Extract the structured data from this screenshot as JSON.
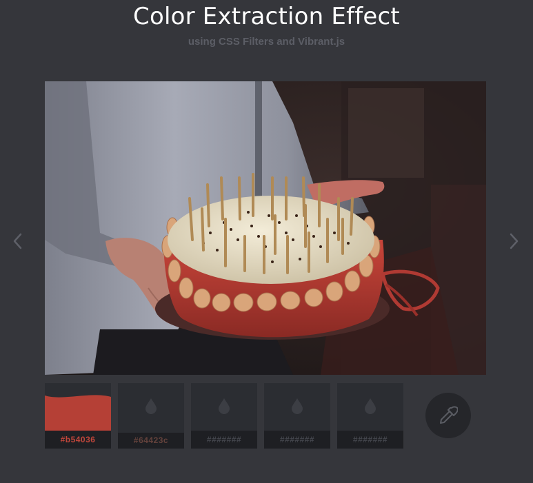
{
  "header": {
    "title": "Color Extraction Effect",
    "subtitle": "using CSS Filters and Vibrant.js"
  },
  "carousel": {
    "prev_icon": "chevron-left-icon",
    "next_icon": "chevron-right-icon",
    "image_subject": "person-holding-birthday-cake"
  },
  "swatches": [
    {
      "label": "#b54036",
      "color": "#b54036",
      "label_color": "#c0463b",
      "state": "extracted"
    },
    {
      "label": "#64423c",
      "color": "#64423c",
      "label_color": "#64423c",
      "state": "pending"
    },
    {
      "label": "#######",
      "color": "",
      "label_color": "#44464d",
      "state": "empty"
    },
    {
      "label": "#######",
      "color": "",
      "label_color": "#44464d",
      "state": "empty"
    },
    {
      "label": "#######",
      "color": "",
      "label_color": "#44464d",
      "state": "empty"
    }
  ],
  "swatch_icon": "droplet-icon",
  "picker": {
    "icon": "eyedropper-icon"
  },
  "colors": {
    "background": "#35363b",
    "swatch_bg": "#2b2d32",
    "label_bg": "#1e1f23",
    "accent_red": "#b54036"
  }
}
